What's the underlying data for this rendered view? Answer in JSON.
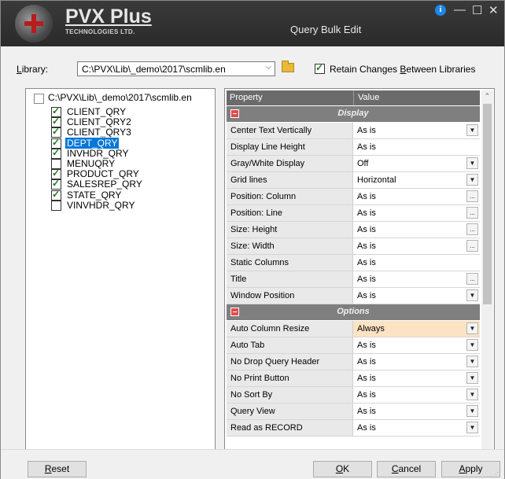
{
  "titlebar": {
    "logo_name": "PVX Plus",
    "logo_sub": "TECHNOLOGIES LTD.",
    "title": "Query Bulk Edit",
    "info_icon": "i",
    "minimize_icon": "—",
    "maximize_icon": "☐",
    "close_icon": "✕"
  },
  "library": {
    "label_pre": "L",
    "label_post": "ibrary:",
    "value": "C:\\PVX\\Lib\\_demo\\2017\\scmlib.en",
    "dropdown_glyph": "⌵",
    "retain_checked": true,
    "retain_pre": "Retain Changes ",
    "retain_ul": "B",
    "retain_post": "etween Libraries"
  },
  "tree": {
    "root": "C:\\PVX\\Lib\\_demo\\2017\\scmlib.en",
    "items": [
      {
        "label": "CLIENT_QRY",
        "checked": true
      },
      {
        "label": "CLIENT_QRY2",
        "checked": true
      },
      {
        "label": "CLIENT_QRY3",
        "checked": true
      },
      {
        "label": "DEPT_QRY",
        "checked": true,
        "selected": true
      },
      {
        "label": "INVHDR_QRY",
        "checked": true
      },
      {
        "label": "MENUQRY",
        "checked": false
      },
      {
        "label": "PRODUCT_QRY",
        "checked": true
      },
      {
        "label": "SALESREP_QRY",
        "checked": true
      },
      {
        "label": "STATE_QRY",
        "checked": true
      },
      {
        "label": "VINVHDR_QRY",
        "checked": false
      }
    ]
  },
  "grid": {
    "col_property": "Property",
    "col_value": "Value",
    "rows": [
      {
        "section": "Display"
      },
      {
        "property": "Center Text Vertically",
        "value": "As is",
        "control": "dropdown"
      },
      {
        "property": "Display Line Height",
        "value": "As is",
        "control": "none"
      },
      {
        "property": "Gray/White Display",
        "value": "Off",
        "control": "dropdown"
      },
      {
        "property": "Grid lines",
        "value": "Horizontal",
        "control": "dropdown"
      },
      {
        "property": "Position: Column",
        "value": "As is",
        "control": "ellipsis"
      },
      {
        "property": "Position: Line",
        "value": "As is",
        "control": "ellipsis"
      },
      {
        "property": "Size: Height",
        "value": "As is",
        "control": "ellipsis"
      },
      {
        "property": "Size: Width",
        "value": "As is",
        "control": "ellipsis"
      },
      {
        "property": "Static Columns",
        "value": "As is",
        "control": "none"
      },
      {
        "property": "Title",
        "value": "As is",
        "control": "ellipsis"
      },
      {
        "property": "Window Position",
        "value": "As is",
        "control": "dropdown"
      },
      {
        "section": "Options"
      },
      {
        "property": "Auto Column Resize",
        "value": "Always",
        "control": "dropdown",
        "highlight": true
      },
      {
        "property": "Auto Tab",
        "value": "As is",
        "control": "dropdown"
      },
      {
        "property": "No Drop Query Header",
        "value": "As is",
        "control": "dropdown"
      },
      {
        "property": "No Print Button",
        "value": "As is",
        "control": "dropdown"
      },
      {
        "property": "No Sort By",
        "value": "As is",
        "control": "dropdown"
      },
      {
        "property": "Query View",
        "value": "As is",
        "control": "dropdown"
      },
      {
        "property": "Read as RECORD",
        "value": "As is",
        "control": "dropdown"
      }
    ],
    "dropdown_glyph": "▼",
    "ellipsis_glyph": "...",
    "scroll_up": "⌃",
    "scroll_down": "⌄"
  },
  "buttons": {
    "reset_ul": "R",
    "reset_post": "eset",
    "ok_ul": "O",
    "ok_post": "K",
    "cancel_ul": "C",
    "cancel_post": "ancel",
    "apply_ul": "A",
    "apply_post": "pply"
  },
  "colors": {
    "titlebar": "#2e2e2e",
    "selection": "#0078d7",
    "highlight_value": "#fbe3c4",
    "section_header": "#7f7f7f"
  }
}
